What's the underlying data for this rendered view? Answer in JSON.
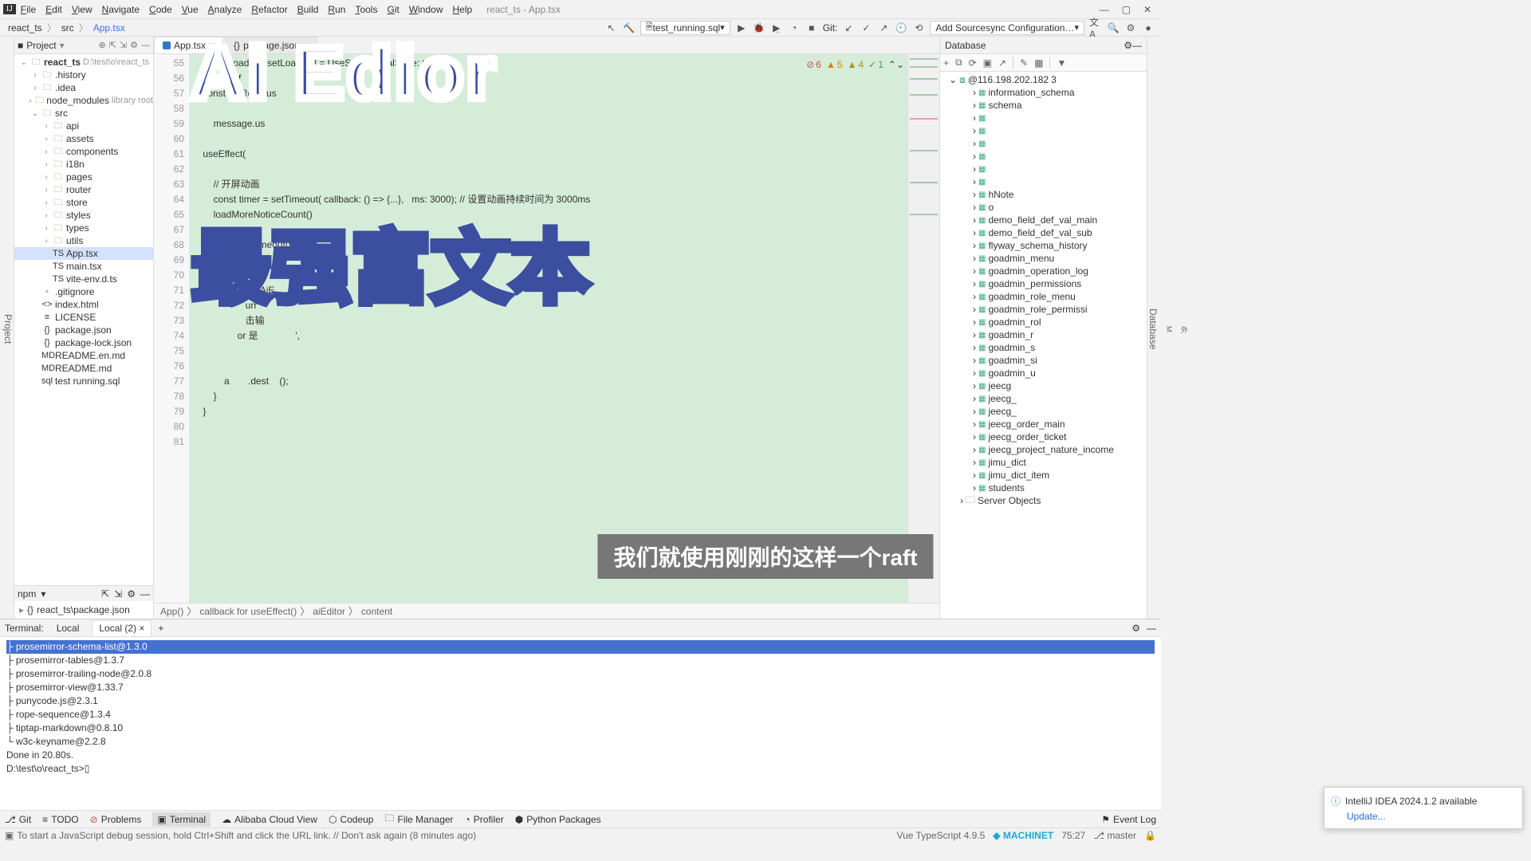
{
  "menu": [
    "File",
    "Edit",
    "View",
    "Navigate",
    "Code",
    "Vue",
    "Analyze",
    "Refactor",
    "Build",
    "Run",
    "Tools",
    "Git",
    "Window",
    "Help"
  ],
  "winTitle": "react_ts - App.tsx",
  "breadcrumb": [
    "react_ts",
    "src",
    "App.tsx"
  ],
  "toolbar": {
    "runConfig": "test_running.sql",
    "git": "Git:",
    "configDD": "Add Sourcesync Configuration…"
  },
  "projectHdr": "Project",
  "projectPath": "D:\\test\\o\\react_ts",
  "tree": [
    {
      "d": 0,
      "e": "v",
      "i": "📁",
      "t": "react_ts",
      "dim": "D:\\test\\o\\react_ts",
      "b": true
    },
    {
      "d": 1,
      "e": ">",
      "i": "📁",
      "t": ".history"
    },
    {
      "d": 1,
      "e": ">",
      "i": "📁",
      "t": ".idea"
    },
    {
      "d": 1,
      "e": ">",
      "i": "📁",
      "t": "node_modules",
      "dim": "library root"
    },
    {
      "d": 1,
      "e": "v",
      "i": "📁",
      "t": "src"
    },
    {
      "d": 2,
      "e": ">",
      "i": "📁",
      "t": "api"
    },
    {
      "d": 2,
      "e": ">",
      "i": "📁",
      "t": "assets"
    },
    {
      "d": 2,
      "e": ">",
      "i": "📁",
      "t": "components"
    },
    {
      "d": 2,
      "e": ">",
      "i": "📁",
      "t": "i18n"
    },
    {
      "d": 2,
      "e": ">",
      "i": "📁",
      "t": "pages"
    },
    {
      "d": 2,
      "e": ">",
      "i": "📁",
      "t": "router"
    },
    {
      "d": 2,
      "e": ">",
      "i": "📁",
      "t": "store"
    },
    {
      "d": 2,
      "e": ">",
      "i": "📁",
      "t": "styles"
    },
    {
      "d": 2,
      "e": ">",
      "i": "📁",
      "t": "types"
    },
    {
      "d": 2,
      "e": ">",
      "i": "📁",
      "t": "utils"
    },
    {
      "d": 2,
      "e": " ",
      "i": "TS",
      "t": "App.tsx",
      "sel": true
    },
    {
      "d": 2,
      "e": " ",
      "i": "TS",
      "t": "main.tsx"
    },
    {
      "d": 2,
      "e": " ",
      "i": "TS",
      "t": "vite-env.d.ts"
    },
    {
      "d": 1,
      "e": " ",
      "i": "◦",
      "t": ".gitignore"
    },
    {
      "d": 1,
      "e": " ",
      "i": "<>",
      "t": "index.html"
    },
    {
      "d": 1,
      "e": " ",
      "i": "≡",
      "t": "LICENSE"
    },
    {
      "d": 1,
      "e": " ",
      "i": "{}",
      "t": "package.json"
    },
    {
      "d": 1,
      "e": " ",
      "i": "{}",
      "t": "package-lock.json"
    },
    {
      "d": 1,
      "e": " ",
      "i": "MD",
      "t": "README.en.md"
    },
    {
      "d": 1,
      "e": " ",
      "i": "MD",
      "t": "README.md"
    },
    {
      "d": 1,
      "e": " ",
      "i": "sql",
      "t": "test running.sql"
    }
  ],
  "npm": {
    "hdr": "npm",
    "item": "react_ts\\package.json"
  },
  "tabs": [
    {
      "t": "App.tsx",
      "a": true
    },
    {
      "t": "package.json",
      "a": false
    }
  ],
  "lines": [
    55,
    56,
    57,
    58,
    59,
    60,
    61,
    62,
    63,
    64,
    65,
    67,
    68,
    69,
    70,
    71,
    72,
    73,
    74,
    75,
    76,
    77,
    78,
    79,
    80,
    81
  ],
  "code": [
    "    const [loading, setLoading] = UseState( initialState: true);",
    "    //定义 ref",
    "    const divRef = us            tialV         ;",
    "",
    "        message.us",
    "",
    "    useEffect(",
    "",
    "        // 开屏动画",
    "        const timer = setTimeout( callback: () => {...},   ms: 3000); // 设置动画持续时间为 3000ms",
    "        loadMoreNoticeCount()",
    "",
    "                     rTimeout(timer)",
    "",
    "                      {",
    "                  new AiE",
    "                    urr",
    "                    击输",
    "                 or 是              ',",
    "",
    "",
    "            a       .dest    ();",
    "        }",
    "    }",
    "",
    ""
  ],
  "inspections": {
    "err": 6,
    "warn": 5,
    "weak": 4,
    "typo": 1
  },
  "bc2": [
    "App()",
    "callback for useEffect()",
    "aiEditor",
    "content"
  ],
  "db": {
    "hdr": "Database",
    "conn": "@116.198.202.182",
    "connNum": "3",
    "items": [
      "information_schema",
      "            schema",
      "",
      "",
      "",
      "",
      "",
      "",
      "    hNote",
      "o",
      "demo_field_def_val_main",
      "demo_field_def_val_sub",
      "flyway_schema_history",
      "goadmin_menu",
      "goadmin_operation_log",
      "goadmin_permissions",
      "goadmin_role_menu",
      "goadmin_role_permissi",
      "goadmin_rol",
      "goadmin_r",
      "goadmin_s",
      "goadmin_si",
      "goadmin_u",
      "jeecg",
      "jeecg_",
      "jeecg_",
      "jeecg_order_main",
      "jeecg_order_ticket",
      "jeecg_project_nature_income",
      "jimu_dict",
      "jimu_dict_item",
      "students"
    ],
    "server": "Server Objects"
  },
  "term": {
    "label": "Terminal:",
    "tabs": [
      "Local",
      "Local (2)"
    ],
    "lines": [
      "├ prosemirror-schema-list@1.3.0",
      "├ prosemirror-tables@1.3.7",
      "├ prosemirror-trailing-node@2.0.8",
      "├ prosemirror-view@1.33.7",
      "├ punycode.js@2.3.1",
      "├ rope-sequence@1.3.4",
      "├ tiptap-markdown@0.8.10",
      "└ w3c-keyname@2.2.8",
      "Done in 20.80s.",
      "",
      "D:\\test\\o\\react_ts>▯"
    ]
  },
  "bottom": [
    "Git",
    "TODO",
    "Problems",
    "Terminal",
    "Alibaba Cloud View",
    "Codeup",
    "File Manager",
    "Profiler",
    "Python Packages"
  ],
  "bottomR": "Event Log",
  "status": {
    "msg": "To start a JavaScript debug session, hold Ctrl+Shift and click the URL link. // Don't ask again (8 minutes ago)",
    "ts": "Vue TypeScript 4.9.5",
    "mach": "MACHINET",
    "pos": "75:27",
    "branch": "master"
  },
  "overlay1": "Ai  Edior",
  "overlay2": "最强富文本",
  "subtitle": "我们就使用刚刚的这样一个raft",
  "notify": {
    "title": "IntelliJ IDEA 2024.1.2 available",
    "link": "Update..."
  }
}
